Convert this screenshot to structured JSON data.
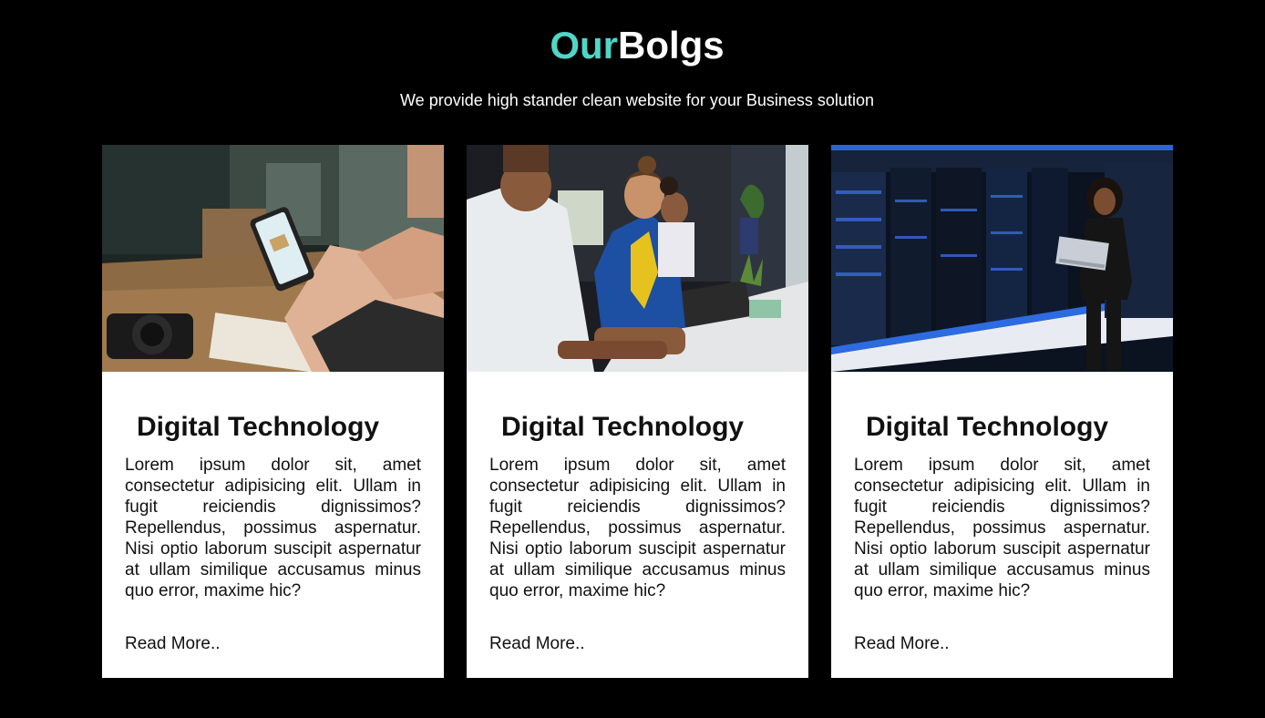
{
  "header": {
    "title_accent": "Our",
    "title_rest": "Bolgs",
    "subtitle": "We provide high stander clean website for your Business solution"
  },
  "colors": {
    "background": "#000000",
    "accent": "#4fd6c6",
    "card_background": "#ffffff"
  },
  "cards": [
    {
      "image": "person-holding-smartphone-photo",
      "title": "Digital Technology",
      "text": "Lorem ipsum dolor sit, amet consectetur adipisicing elit. Ullam in fugit reiciendis dignissimos? Repellendus, possimus aspernatur. Nisi optio laborum suscipit aspernatur at ullam similique accusamus minus quo error, maxime hic?",
      "link": "Read More.."
    },
    {
      "image": "smiling-office-workers-photo",
      "title": "Digital Technology",
      "text": "Lorem ipsum dolor sit, amet consectetur adipisicing elit. Ullam in fugit reiciendis dignissimos? Repellendus, possimus aspernatur. Nisi optio laborum suscipit aspernatur at ullam similique accusamus minus quo error, maxime hic?",
      "link": "Read More.."
    },
    {
      "image": "woman-in-server-room-photo",
      "title": "Digital Technology",
      "text": "Lorem ipsum dolor sit, amet consectetur adipisicing elit. Ullam in fugit reiciendis dignissimos? Repellendus, possimus aspernatur. Nisi optio laborum suscipit aspernatur at ullam similique accusamus minus quo error, maxime hic?",
      "link": "Read More.."
    }
  ]
}
